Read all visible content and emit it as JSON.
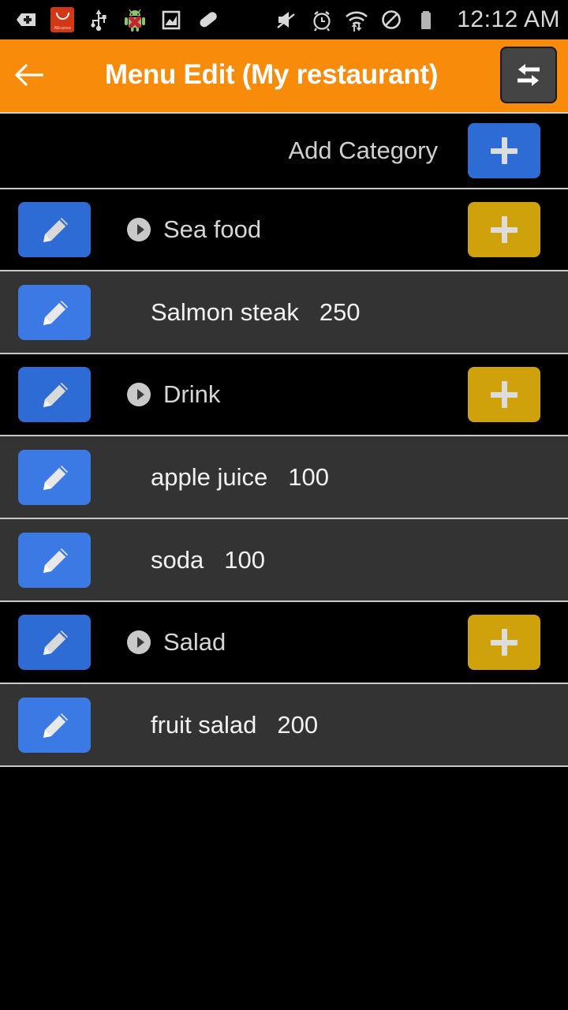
{
  "status_bar": {
    "icons": [
      {
        "name": "add-badge-icon",
        "glyph": "plus-badge"
      },
      {
        "name": "aliexpress-icon",
        "label": "AliExpress"
      },
      {
        "name": "usb-icon",
        "glyph": "usb"
      },
      {
        "name": "android-debug-icon",
        "glyph": "android-x"
      },
      {
        "name": "screenshot-icon",
        "glyph": "image"
      },
      {
        "name": "pill-icon",
        "glyph": "capsule"
      },
      {
        "name": "mute-icon",
        "glyph": "volume-mute"
      },
      {
        "name": "alarm-icon",
        "glyph": "alarm-clock"
      },
      {
        "name": "wifi-data-icon",
        "glyph": "wifi-updown"
      },
      {
        "name": "do-not-disturb-icon",
        "glyph": "block"
      },
      {
        "name": "battery-icon",
        "glyph": "battery-full"
      }
    ],
    "clock": "12:12 AM"
  },
  "header": {
    "back_label": "←",
    "title": "Menu Edit (My restaurant)",
    "swap_button_name": "swap-order-button",
    "background_color": "#f98b0a"
  },
  "add_category_bar": {
    "label": "Add Category",
    "button_label": "+",
    "button_color": "#2d6cd4"
  },
  "colors": {
    "accent_orange": "#f98b0a",
    "blue_button": "#2d6cd4",
    "gold_button": "#cfa20c",
    "category_row_bg": "#000000",
    "item_row_bg": "#333333",
    "divider": "#c9c9c9"
  },
  "list": [
    {
      "type": "category",
      "name": "Sea food",
      "edit_button": "edit",
      "add_button": "+",
      "expandable": true
    },
    {
      "type": "item",
      "name": "Salmon steak",
      "price": "250",
      "edit_button": "edit"
    },
    {
      "type": "category",
      "name": "Drink",
      "edit_button": "edit",
      "add_button": "+",
      "expandable": true
    },
    {
      "type": "item",
      "name": "apple juice",
      "price": "100",
      "edit_button": "edit"
    },
    {
      "type": "item",
      "name": "soda",
      "price": "100",
      "edit_button": "edit"
    },
    {
      "type": "category",
      "name": "Salad",
      "edit_button": "edit",
      "add_button": "+",
      "expandable": true
    },
    {
      "type": "item",
      "name": "fruit salad",
      "price": "200",
      "edit_button": "edit"
    }
  ]
}
